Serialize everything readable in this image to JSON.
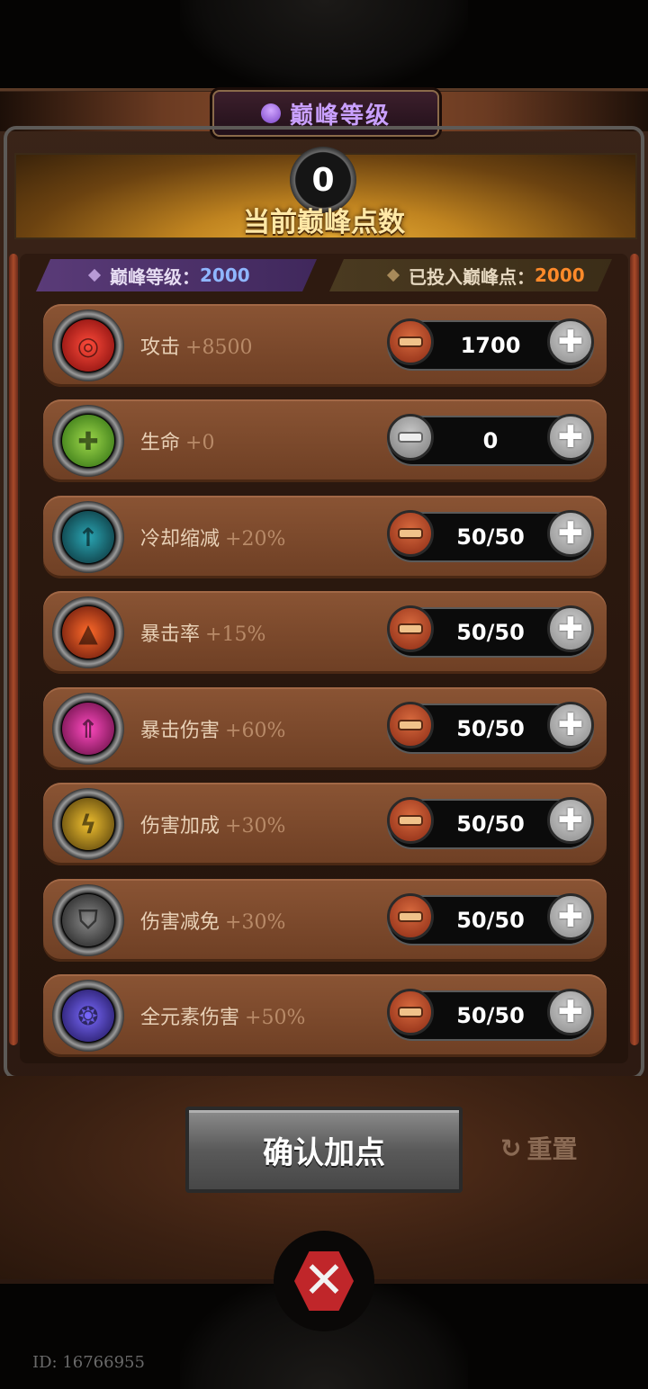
{
  "header": {
    "title": "巅峰等级"
  },
  "points": {
    "value": "0",
    "label": "当前巅峰点数"
  },
  "tags": {
    "level_label": "巅峰等级：",
    "level_value": "2000",
    "invested_label": "已投入巅峰点：",
    "invested_value": "2000"
  },
  "stats": [
    {
      "name": "攻击",
      "bonus": "+8500",
      "value": "1700",
      "icon": "target-icon",
      "color": "#c81e22",
      "minus_enabled": true
    },
    {
      "name": "生命",
      "bonus": "+0",
      "value": "0",
      "icon": "health-icon",
      "color": "#5aa82e",
      "minus_enabled": false
    },
    {
      "name": "冷却缩减",
      "bonus": "+20%",
      "value": "50/50",
      "icon": "cooldown-icon",
      "color": "#1e7c86",
      "minus_enabled": true
    },
    {
      "name": "暴击率",
      "bonus": "+15%",
      "value": "50/50",
      "icon": "flame-icon",
      "color": "#c84a1e",
      "minus_enabled": true
    },
    {
      "name": "暴击伤害",
      "bonus": "+60%",
      "value": "50/50",
      "icon": "arrow-burst-icon",
      "color": "#c81e8a",
      "minus_enabled": true
    },
    {
      "name": "伤害加成",
      "bonus": "+30%",
      "value": "50/50",
      "icon": "lightning-icon",
      "color": "#c8a01e",
      "minus_enabled": true
    },
    {
      "name": "伤害减免",
      "bonus": "+30%",
      "value": "50/50",
      "icon": "shield-icon",
      "color": "#6a6a6a",
      "minus_enabled": true
    },
    {
      "name": "全元素伤害",
      "bonus": "+50%",
      "value": "50/50",
      "icon": "elements-icon",
      "color": "#4a3aa8",
      "minus_enabled": true
    }
  ],
  "actions": {
    "confirm_label": "确认加点",
    "reset_label": "重置"
  },
  "footer": {
    "id_text": "ID: 16766955"
  },
  "colors": {
    "level_value": "#8fb6ff",
    "invested_value": "#ff8a2a",
    "title": "#c9a0ff"
  }
}
